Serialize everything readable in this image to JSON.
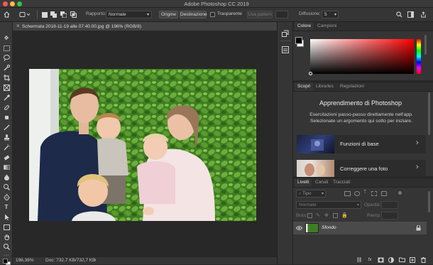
{
  "app": {
    "title": "Adobe Photoshop CC 2019"
  },
  "window_controls": {
    "close_color": "#fc5753",
    "minimize_color": "#fdbc40",
    "zoom_color": "#33c748"
  },
  "options_bar": {
    "ratio_label": "Rapporto:",
    "ratio_value": "Normale",
    "source_label": "Origine",
    "destination_label": "Destinazione",
    "transparent_label": "Trasparente",
    "use_pattern_label": "Usa pattern",
    "diffusion_label": "Diffusione:",
    "diffusion_value": "5"
  },
  "document": {
    "tab_title": "Schermata 2018-11-19 alle 07.40.00.jpg @ 196% (RGB/8)",
    "close_glyph": "×"
  },
  "status": {
    "zoom": "196,36%",
    "doc_info": "Doc: 732,7 KB/732,7 KB"
  },
  "color_panel": {
    "tabs": [
      "Colore",
      "Campioni"
    ],
    "foreground_color": "#000000",
    "background_color": "#ffffff",
    "hue_color": "#ff0000"
  },
  "learn_panel": {
    "tabs": [
      "Scopri",
      "Librarles",
      "Regolazioni"
    ],
    "heading": "Apprendimento di Photoshop",
    "description": "Esercitazioni passo-passo direttamente nell'app. Selezionate un argomento qui sotto per iniziare.",
    "topics": [
      "Funzioni di base",
      "Correggere una foto"
    ]
  },
  "layers_panel": {
    "tabs": [
      "Livelli",
      "Canali",
      "Tracciati"
    ],
    "kind_label": "Tipo",
    "blend_mode": "Normale",
    "opacity_label": "Opacità:",
    "lock_label": "Blocc:",
    "fill_label": "Riemp.:",
    "layers": [
      {
        "name": "Sfondo",
        "visible": true,
        "locked": true
      }
    ]
  },
  "accent_color": "#3d7ee6"
}
